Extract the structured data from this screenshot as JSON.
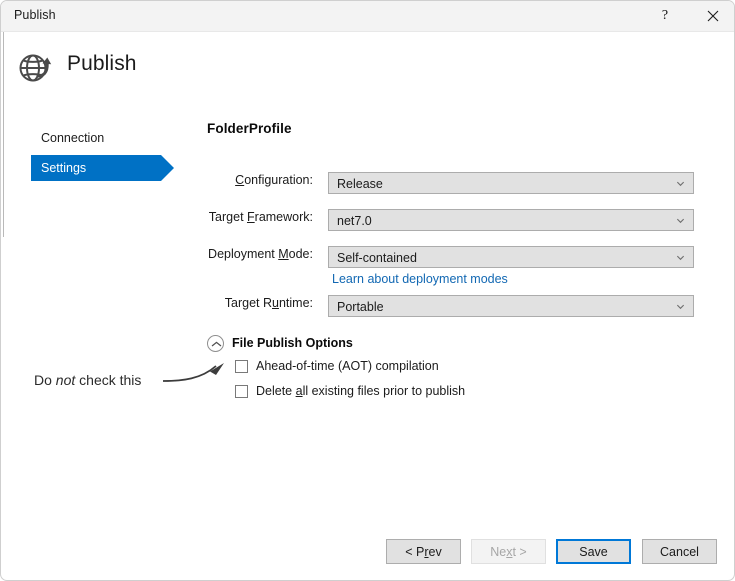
{
  "window": {
    "title": "Publish",
    "help_icon": "?",
    "close_icon": "close-icon"
  },
  "header": {
    "icon": "publish-globe-icon",
    "title": "Publish"
  },
  "sidebar": {
    "items": [
      {
        "label": "Connection",
        "selected": false
      },
      {
        "label": "Settings",
        "selected": true
      }
    ],
    "selected_color": "#0071c5"
  },
  "main": {
    "profile_title": "FolderProfile",
    "fields": [
      {
        "label_pre": "",
        "label_mnemonic": "C",
        "label_post": "onfiguration:",
        "value": "Release",
        "icon": "chevron-down-icon"
      },
      {
        "label_pre": "Target ",
        "label_mnemonic": "F",
        "label_post": "ramework:",
        "value": "net7.0",
        "icon": "chevron-down-icon"
      },
      {
        "label_pre": "Deployment ",
        "label_mnemonic": "M",
        "label_post": "ode:",
        "value": "Self-contained",
        "icon": "chevron-down-icon"
      },
      {
        "label_pre": "Target R",
        "label_mnemonic": "u",
        "label_post": "ntime:",
        "value": "Portable",
        "icon": "chevron-down-icon"
      }
    ],
    "link": {
      "text": "Learn about deployment modes",
      "color": "#1268b3"
    },
    "file_publish_options": {
      "title": "File Publish Options",
      "toggle_icon": "chevron-up-icon",
      "expanded": true,
      "checkboxes": [
        {
          "label_pre": "Ahead-of-time (AOT) compilation",
          "label_mnemonic": "",
          "label_post": "",
          "checked": false
        },
        {
          "label_pre": "Delete ",
          "label_mnemonic": "a",
          "label_post": "ll existing files prior to publish",
          "checked": false
        }
      ]
    }
  },
  "annotation": {
    "text_pre": "Do ",
    "text_italic": "not",
    "text_post": " check this",
    "arrow_icon": "curved-arrow-icon"
  },
  "footer": {
    "buttons": [
      {
        "pre": "< P",
        "mnemonic": "r",
        "post": "ev",
        "name": "prev",
        "state": "enabled"
      },
      {
        "pre": "Ne",
        "mnemonic": "x",
        "post": "t >",
        "name": "next",
        "state": "disabled"
      },
      {
        "pre": "Save",
        "mnemonic": "",
        "post": "",
        "name": "save",
        "state": "focused"
      },
      {
        "pre": "Cancel",
        "mnemonic": "",
        "post": "",
        "name": "cancel",
        "state": "enabled"
      }
    ],
    "focus_color": "#0078d7"
  }
}
